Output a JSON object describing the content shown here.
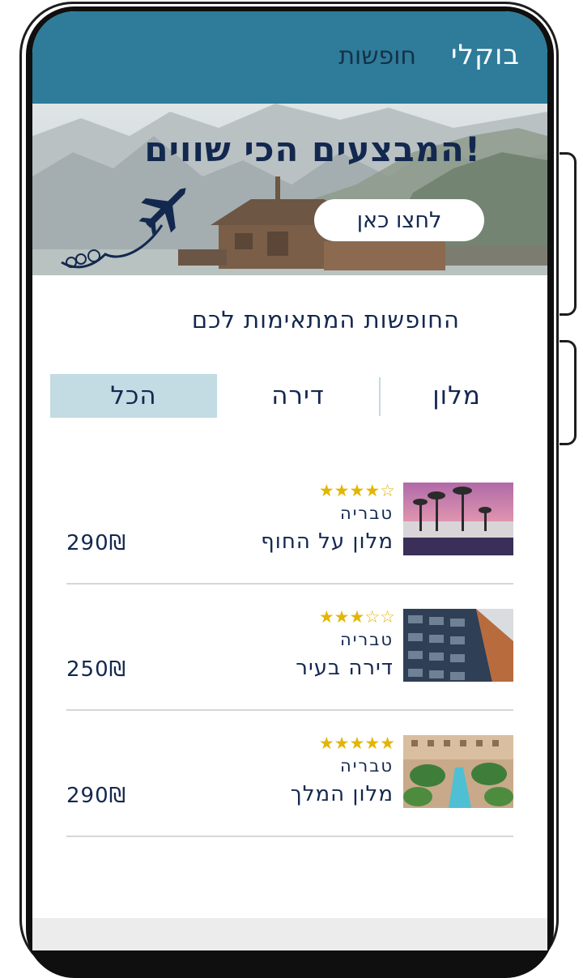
{
  "header": {
    "logo": "בוקלי",
    "nav_link": "חופשות"
  },
  "banner": {
    "title": "המבצעים הכי שווים!",
    "button_label": "לחצו כאן"
  },
  "section": {
    "title": "החופשות המתאימות לכם"
  },
  "tabs": [
    {
      "label": "הכל",
      "active": true
    },
    {
      "label": "דירה",
      "active": false
    },
    {
      "label": "מלון",
      "active": false
    }
  ],
  "listings": [
    {
      "stars_display": "★★★★☆",
      "rating": 4,
      "city": "טבריה",
      "name": "מלון על החוף",
      "price": "290₪"
    },
    {
      "stars_display": "★★★☆☆",
      "rating": 3,
      "city": "טבריה",
      "name": "דירה בעיר",
      "price": "250₪"
    },
    {
      "stars_display": "★★★★★",
      "rating": 5,
      "city": "טבריה",
      "name": "מלון המלך",
      "price": "290₪"
    }
  ],
  "colors": {
    "header_bg": "#2e7b9a",
    "title_navy": "#13284f",
    "star_gold": "#e3b505",
    "active_tab": "#c3dbe3"
  }
}
